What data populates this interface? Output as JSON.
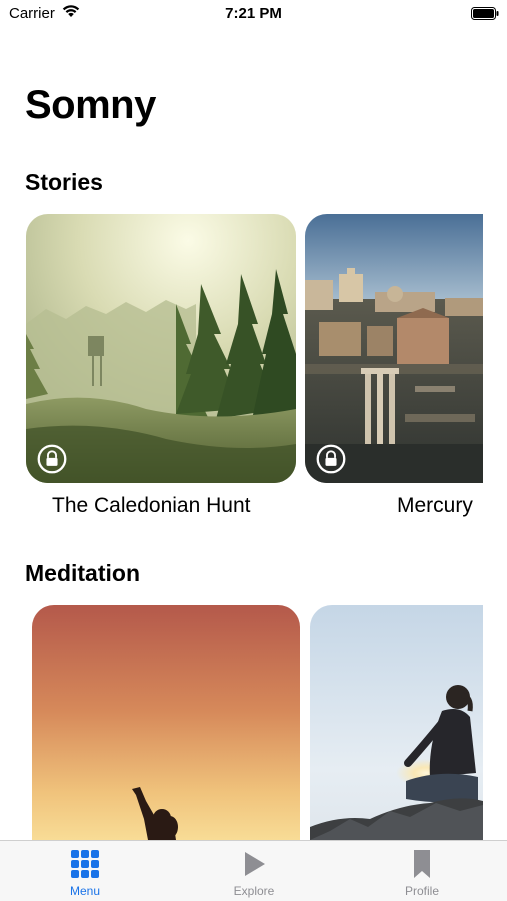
{
  "status_bar": {
    "carrier": "Carrier",
    "time": "7:21 PM",
    "icons": [
      "wifi-icon",
      "battery-icon"
    ]
  },
  "app": {
    "title": "Somny"
  },
  "sections": {
    "stories": {
      "title": "Stories",
      "items": [
        {
          "caption": "The Caledonian Hunt",
          "locked": true,
          "image": "misty-forest"
        },
        {
          "caption": "Mercury",
          "locked": true,
          "image": "roman-forum-ruins"
        }
      ]
    },
    "meditation": {
      "title": "Meditation",
      "items": [
        {
          "image": "sunset-silhouette"
        },
        {
          "image": "seated-meditation-on-rocks"
        }
      ]
    }
  },
  "tab_bar": {
    "tabs": [
      {
        "label": "Menu",
        "icon": "grid-icon",
        "selected": true
      },
      {
        "label": "Explore",
        "icon": "play-icon",
        "selected": false
      },
      {
        "label": "Profile",
        "icon": "bookmark-icon",
        "selected": false
      }
    ],
    "colors": {
      "selected": "#1a73e8",
      "unselected": "#8e8e93"
    }
  }
}
